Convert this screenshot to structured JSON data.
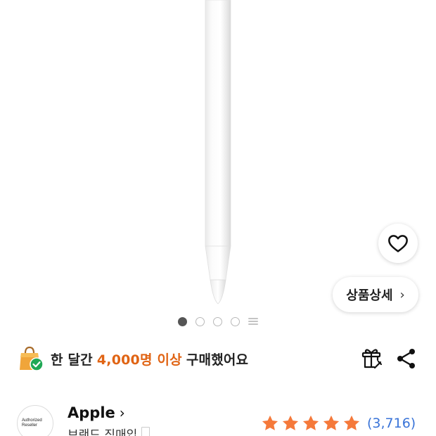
{
  "gallery": {
    "total_pages": 5,
    "current_page": 1
  },
  "detail_button": {
    "label": "상품상세",
    "chevron": "›"
  },
  "wishlist": {
    "icon": "heart-outline-icon"
  },
  "social_proof": {
    "prefix": "한 달간",
    "highlight": "4,000명 이상",
    "suffix": "구매했어요",
    "highlight_color": "#e06414"
  },
  "brand": {
    "badge_text_1": "Authorized",
    "badge_text_2": "Reseller",
    "name": "Apple",
    "chevron": "›",
    "subtitle": "브랜드 직매입"
  },
  "rating": {
    "stars": 5,
    "max_stars": 5,
    "star_color": "#f5793a",
    "review_count": "(3,716)",
    "count_color": "#3a74d8"
  }
}
